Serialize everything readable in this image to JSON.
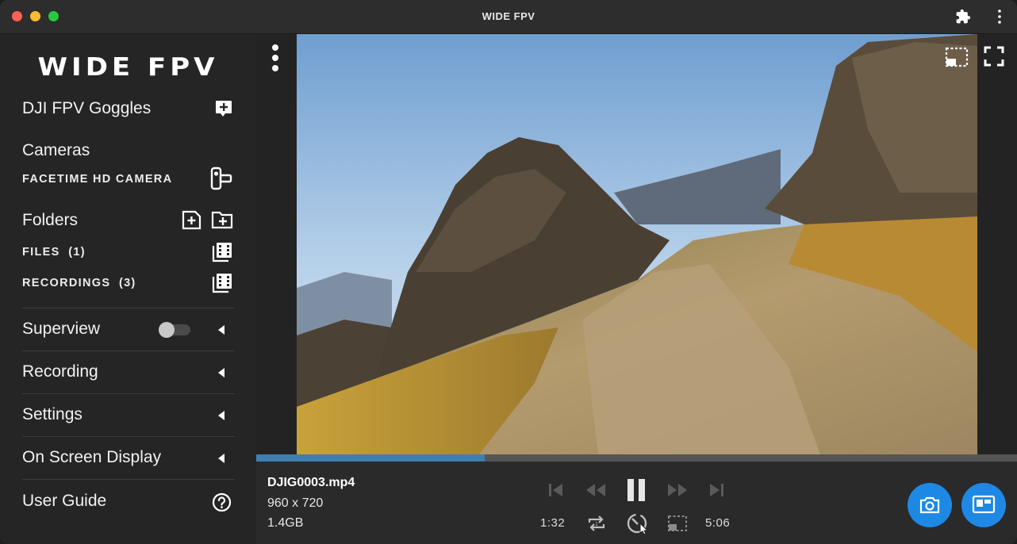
{
  "window": {
    "title": "WIDE FPV"
  },
  "sidebar": {
    "logo": "WIDE FPV",
    "goggles_label": "DJI FPV Goggles",
    "cameras_heading": "Cameras",
    "camera_item": "FACETIME HD CAMERA",
    "folders_heading": "Folders",
    "files_item": "FILES  (1)",
    "recordings_item": "RECORDINGS  (3)",
    "superview_label": "Superview",
    "superview_enabled": false,
    "recording_label": "Recording",
    "settings_label": "Settings",
    "osd_label": "On Screen Display",
    "user_guide_label": "User Guide"
  },
  "player": {
    "file_name": "DJIG0003.mp4",
    "resolution": "960 x 720",
    "file_size": "1.4GB",
    "current_time": "1:32",
    "total_time": "5:06",
    "progress_fraction": 0.3,
    "state": "playing"
  },
  "colors": {
    "accent": "#1e88e5",
    "progress": "#3e7fb0"
  },
  "icons": [
    "puzzle-icon",
    "kebab-menu-icon",
    "add-goggles-icon",
    "camera-device-icon",
    "add-file-icon",
    "add-folder-icon",
    "film-library-icon",
    "help-circle-icon",
    "crop-icon",
    "fullscreen-icon",
    "skip-previous-icon",
    "rewind-icon",
    "pause-icon",
    "fast-forward-icon",
    "skip-next-icon",
    "repeat-icon",
    "speed-icon",
    "crop-toggle-icon",
    "snapshot-icon",
    "picture-in-picture-icon"
  ]
}
